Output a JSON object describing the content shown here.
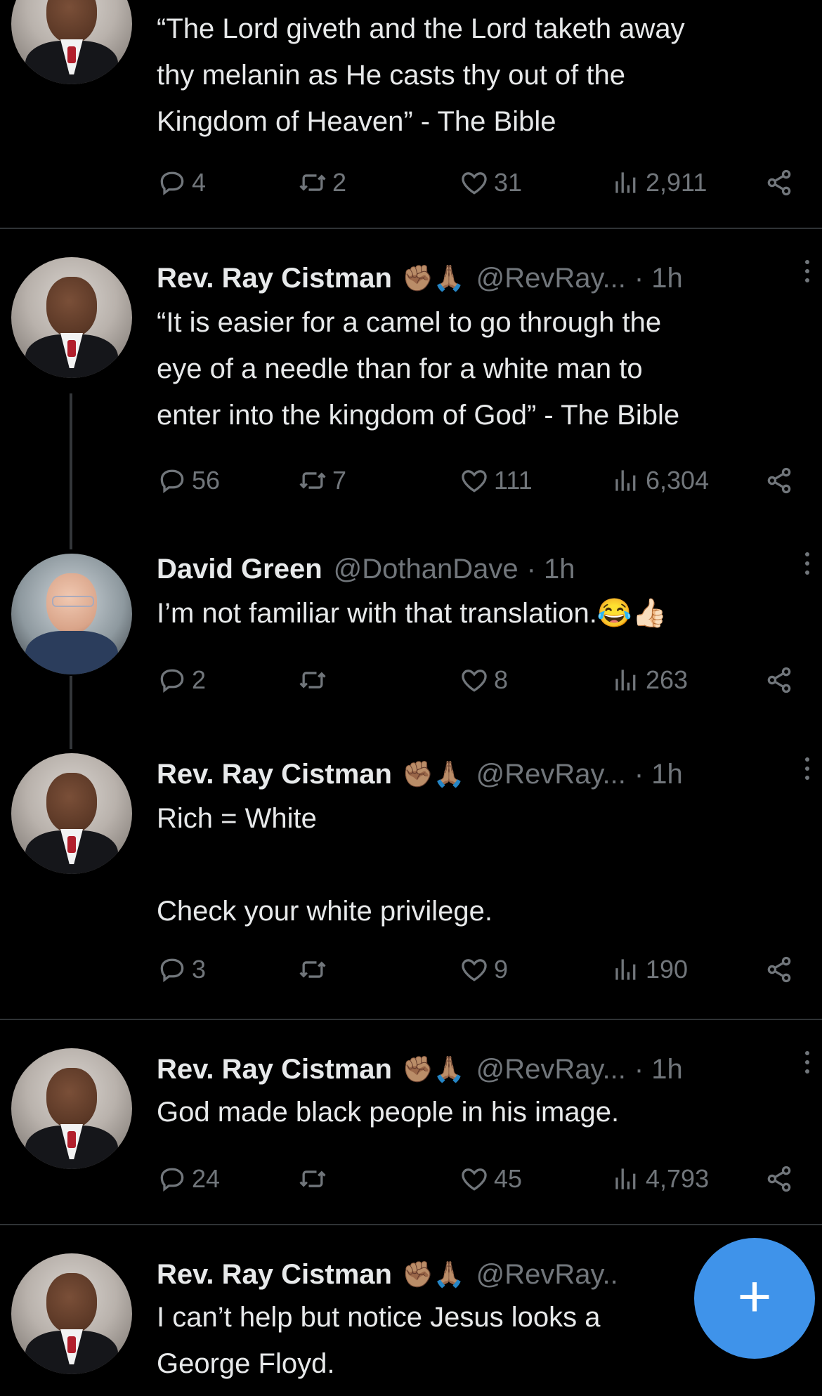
{
  "tweets": [
    {
      "name": "",
      "badges": "",
      "handle": "",
      "time": "",
      "text": "“The Lord giveth and the Lord taketh away\nthy melanin as He casts thy out of the\nKingdom of Heaven” - The Bible",
      "reply": "4",
      "retweet": "2",
      "like": "31",
      "views": "2,911"
    },
    {
      "name": "Rev. Ray Cistman",
      "badges": "✊🏽🙏🏽",
      "handle": "@RevRay...",
      "time": "· 1h",
      "text": "“It is easier for a camel to go through the\neye of a needle than for a white man to\nenter into the kingdom of God” - The Bible",
      "reply": "56",
      "retweet": "7",
      "like": "111",
      "views": "6,304"
    },
    {
      "name": "David Green",
      "badges": "",
      "handle": "@DothanDave",
      "time": "· 1h",
      "text": "I’m not familiar with that translation.😂👍🏻",
      "reply": "2",
      "retweet": "",
      "like": "8",
      "views": "263"
    },
    {
      "name": "Rev. Ray Cistman",
      "badges": "✊🏽🙏🏽",
      "handle": "@RevRay...",
      "time": "· 1h",
      "text": "Rich = White\n\nCheck your white privilege.",
      "reply": "3",
      "retweet": "",
      "like": "9",
      "views": "190"
    },
    {
      "name": "Rev. Ray Cistman",
      "badges": "✊🏽🙏🏽",
      "handle": "@RevRay...",
      "time": "· 1h",
      "text": "God made black people in his image.",
      "reply": "24",
      "retweet": "",
      "like": "45",
      "views": "4,793"
    },
    {
      "name": "Rev. Ray Cistman",
      "badges": "✊🏽🙏🏽",
      "handle": "@RevRay..",
      "time": "",
      "text": "I can’t help but notice Jesus looks a\nGeorge Floyd.",
      "reply": "",
      "retweet": "",
      "like": "",
      "views": ""
    }
  ],
  "fab": {
    "label": "+"
  },
  "colors": {
    "background": "#000000",
    "text": "#e7e9ea",
    "muted": "#71767b",
    "accent": "#3f93ea"
  },
  "icons": [
    "reply-icon",
    "retweet-icon",
    "like-icon",
    "views-icon",
    "share-icon",
    "more-icon",
    "compose-icon"
  ]
}
